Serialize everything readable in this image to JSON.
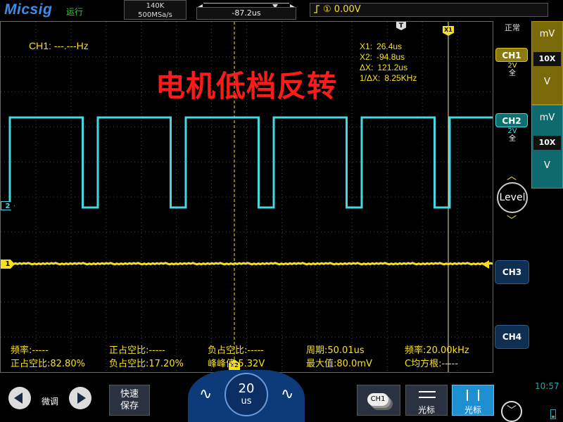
{
  "header": {
    "logo": "Micsig",
    "run_status": "运行",
    "memory_depth": "140K",
    "sample_rate": "500MSa/s",
    "time_offset": "-87.2us",
    "trigger_channel": "①",
    "trigger_level": "0.00V"
  },
  "screen": {
    "ch1_frequency": "CH1: ---.---Hz",
    "overlay_title": "电机低档反转",
    "cursors": {
      "x1": {
        "label": "X1:",
        "value": "26.4us"
      },
      "x2": {
        "label": "X2:",
        "value": "-94.8us"
      },
      "dx": {
        "label": "ΔX:",
        "value": "121.2us"
      },
      "inv_dx": {
        "label": "1/ΔX:",
        "value": "8.25KHz"
      }
    },
    "markers": {
      "ch1": "1",
      "ch2": "2",
      "trigger": "T",
      "x1": "X1",
      "x2": "X2"
    },
    "measurements": [
      {
        "label": "频率:-----"
      },
      {
        "label": "正占空比:-----"
      },
      {
        "label": "负占空比:-----"
      },
      {
        "label": "周期:50.01us"
      },
      {
        "label": "频率:20.00kHz"
      },
      {
        "label": "正占空比:82.80%"
      },
      {
        "label": "负占空比:17.20%"
      },
      {
        "label": "峰峰值:5.32V"
      },
      {
        "label": "最大值:80.0mV"
      },
      {
        "label": "C均方根:-----"
      }
    ]
  },
  "sidebar": {
    "mode": "正常",
    "ch1": {
      "label": "CH1",
      "volts": "2V",
      "bandwidth": "全"
    },
    "ch2": {
      "label": "CH2",
      "volts": "2V",
      "bandwidth": "全"
    },
    "ch1_scale": {
      "unit": "mV",
      "probe": "10X",
      "down": "V"
    },
    "ch2_scale": {
      "unit": "mV",
      "probe": "10X",
      "down": "V"
    },
    "level_label": "Level",
    "ch3": "CH3",
    "ch4": "CH4"
  },
  "footer": {
    "fine_label": "微调",
    "quick_save": "快速保存",
    "timebase_value": "20",
    "timebase_unit": "us",
    "ch_select": "CH1",
    "cursor_h_label": "光标",
    "cursor_v_label": "光标",
    "clock": "10:57"
  },
  "colors": {
    "ch1": "#f5e020",
    "ch2": "#46d7e0",
    "title": "#ff1a1a"
  },
  "traces": {
    "ch2": {
      "period_us": 50.01,
      "positive_duty_pct": 82.8
    },
    "ch1": {
      "level_v": 0.0
    }
  }
}
